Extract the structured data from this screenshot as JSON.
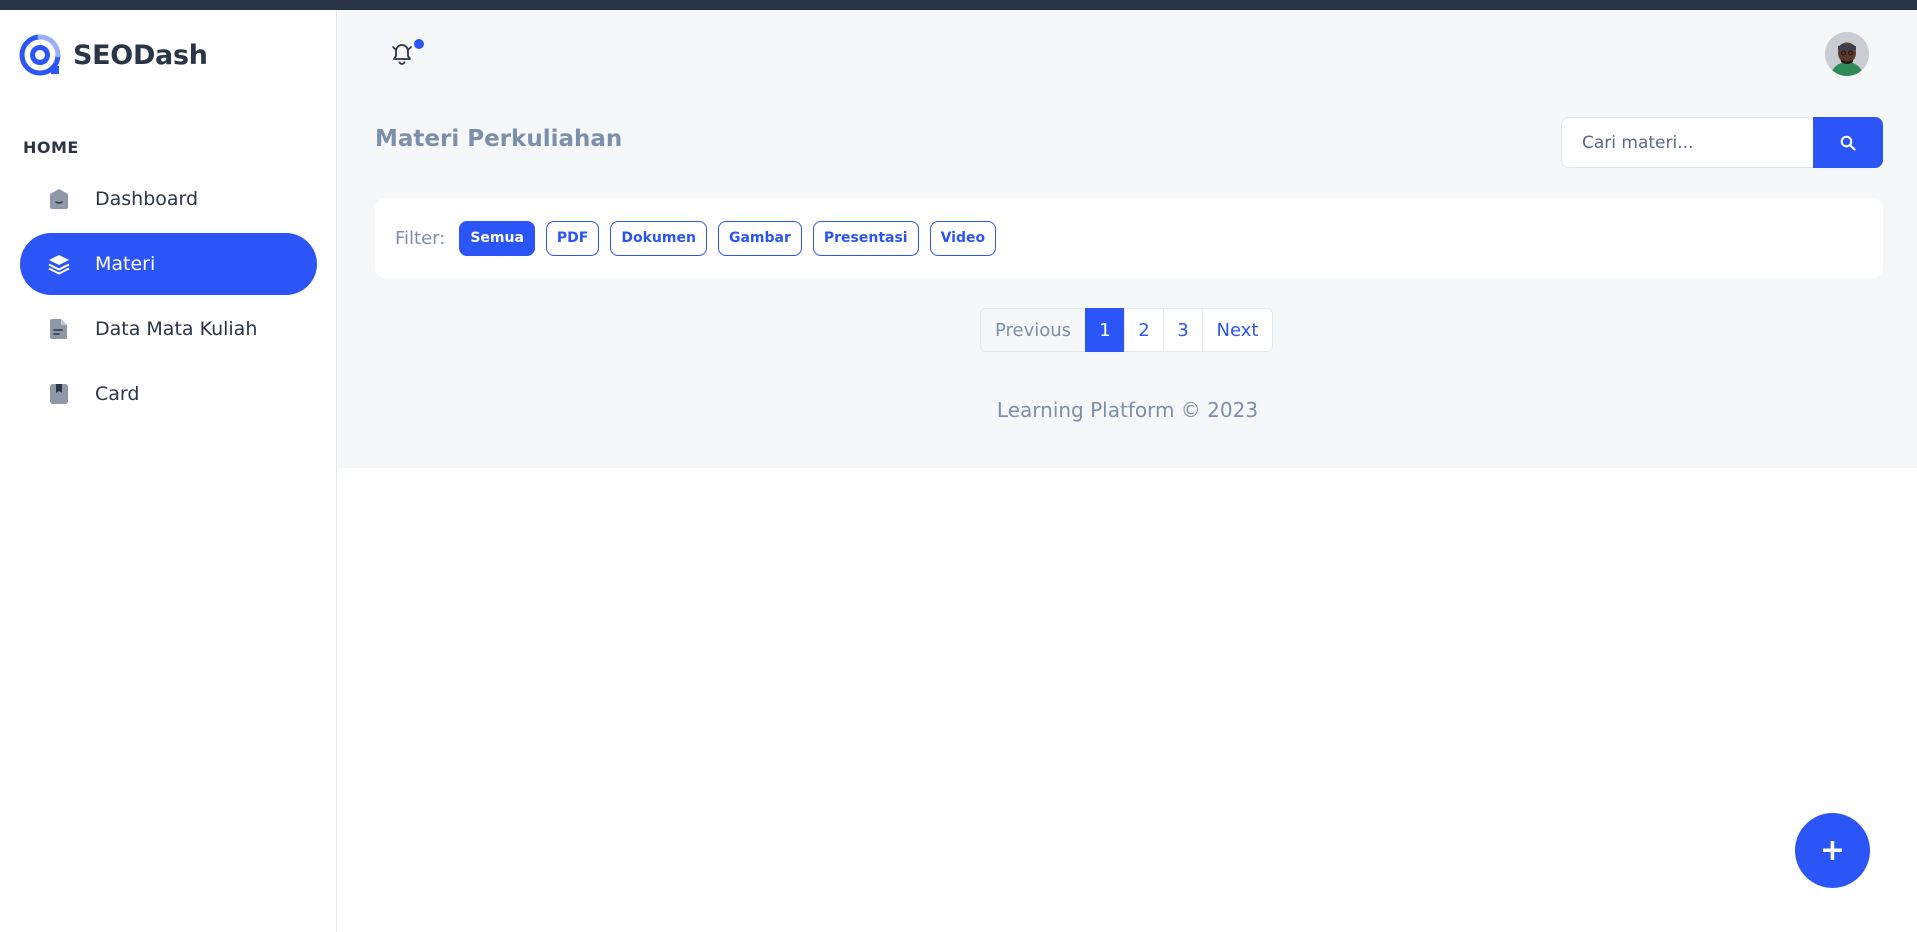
{
  "brand": {
    "name": "SEODash",
    "logo_icon": "seodash-logo-icon"
  },
  "sidebar": {
    "heading": "HOME",
    "items": [
      {
        "label": "Dashboard",
        "icon": "home-icon",
        "active": false
      },
      {
        "label": "Materi",
        "icon": "layers-icon",
        "active": true
      },
      {
        "label": "Data Mata Kuliah",
        "icon": "file-icon",
        "active": false
      },
      {
        "label": "Card",
        "icon": "bookmark-icon",
        "active": false
      }
    ]
  },
  "header": {
    "notification_icon": "bell-icon",
    "has_unread": true,
    "avatar_icon": "user-avatar"
  },
  "main": {
    "title": "Materi Perkuliahan",
    "search": {
      "placeholder": "Cari materi...",
      "value": "",
      "button_icon": "search-icon"
    },
    "filter": {
      "label": "Filter:",
      "chips": [
        {
          "label": "Semua",
          "active": true
        },
        {
          "label": "PDF",
          "active": false
        },
        {
          "label": "Dokumen",
          "active": false
        },
        {
          "label": "Gambar",
          "active": false
        },
        {
          "label": "Presentasi",
          "active": false
        },
        {
          "label": "Video",
          "active": false
        }
      ]
    },
    "pagination": {
      "previous": "Previous",
      "pages": [
        "1",
        "2",
        "3"
      ],
      "current": "1",
      "next": "Next"
    },
    "footer": "Learning Platform © 2023"
  },
  "fab": {
    "label": "+",
    "icon": "plus-icon"
  },
  "colors": {
    "primary": "#2b55f6",
    "text": "#2a3547",
    "muted": "#7c8fac",
    "background": "#f6f7f9",
    "topbar": "#2a3547"
  }
}
